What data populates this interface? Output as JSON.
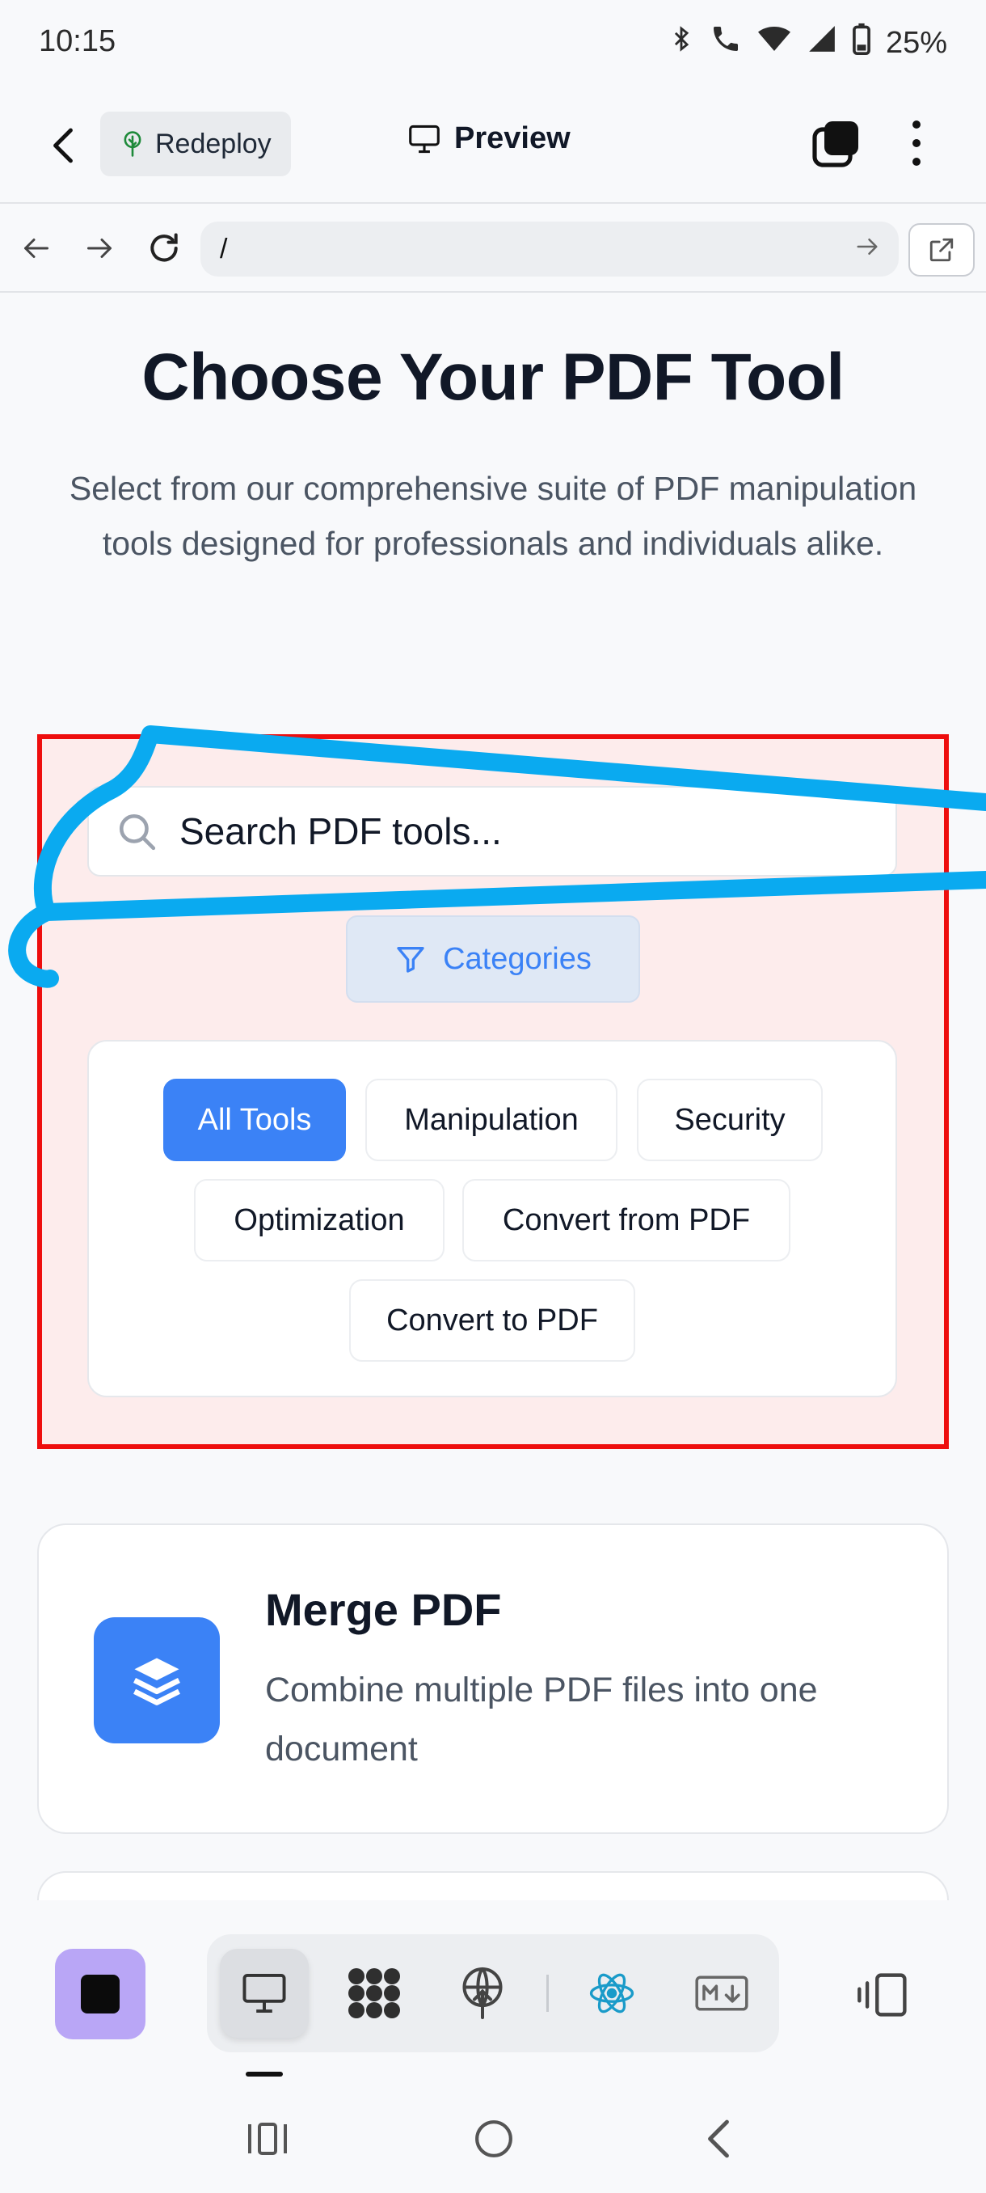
{
  "status_bar": {
    "time": "10:15",
    "battery": "25%"
  },
  "app_header": {
    "redeploy_label": "Redeploy",
    "preview_label": "Preview"
  },
  "url_bar": {
    "url": "/"
  },
  "hero": {
    "title": "Choose Your PDF Tool",
    "subtitle": "Select from our comprehensive suite of PDF manipulation tools designed for professionals and individuals alike."
  },
  "filters": {
    "search_placeholder": "Search PDF tools...",
    "categories_label": "Categories",
    "chips": [
      "All Tools",
      "Manipulation",
      "Security",
      "Optimization",
      "Convert from PDF",
      "Convert to PDF"
    ],
    "active_chip": "All Tools"
  },
  "tools": [
    {
      "title": "Merge PDF",
      "description": "Combine multiple PDF files into one document",
      "icon": "layers-icon"
    }
  ],
  "colors": {
    "accent": "#3b82f6",
    "highlight_border": "#ee0e0e",
    "highlight_fill": "#fdecec",
    "annotation_stroke": "#0aaaf0",
    "project_button": "#b9a6f6",
    "react_icon": "#1a9bc9"
  }
}
